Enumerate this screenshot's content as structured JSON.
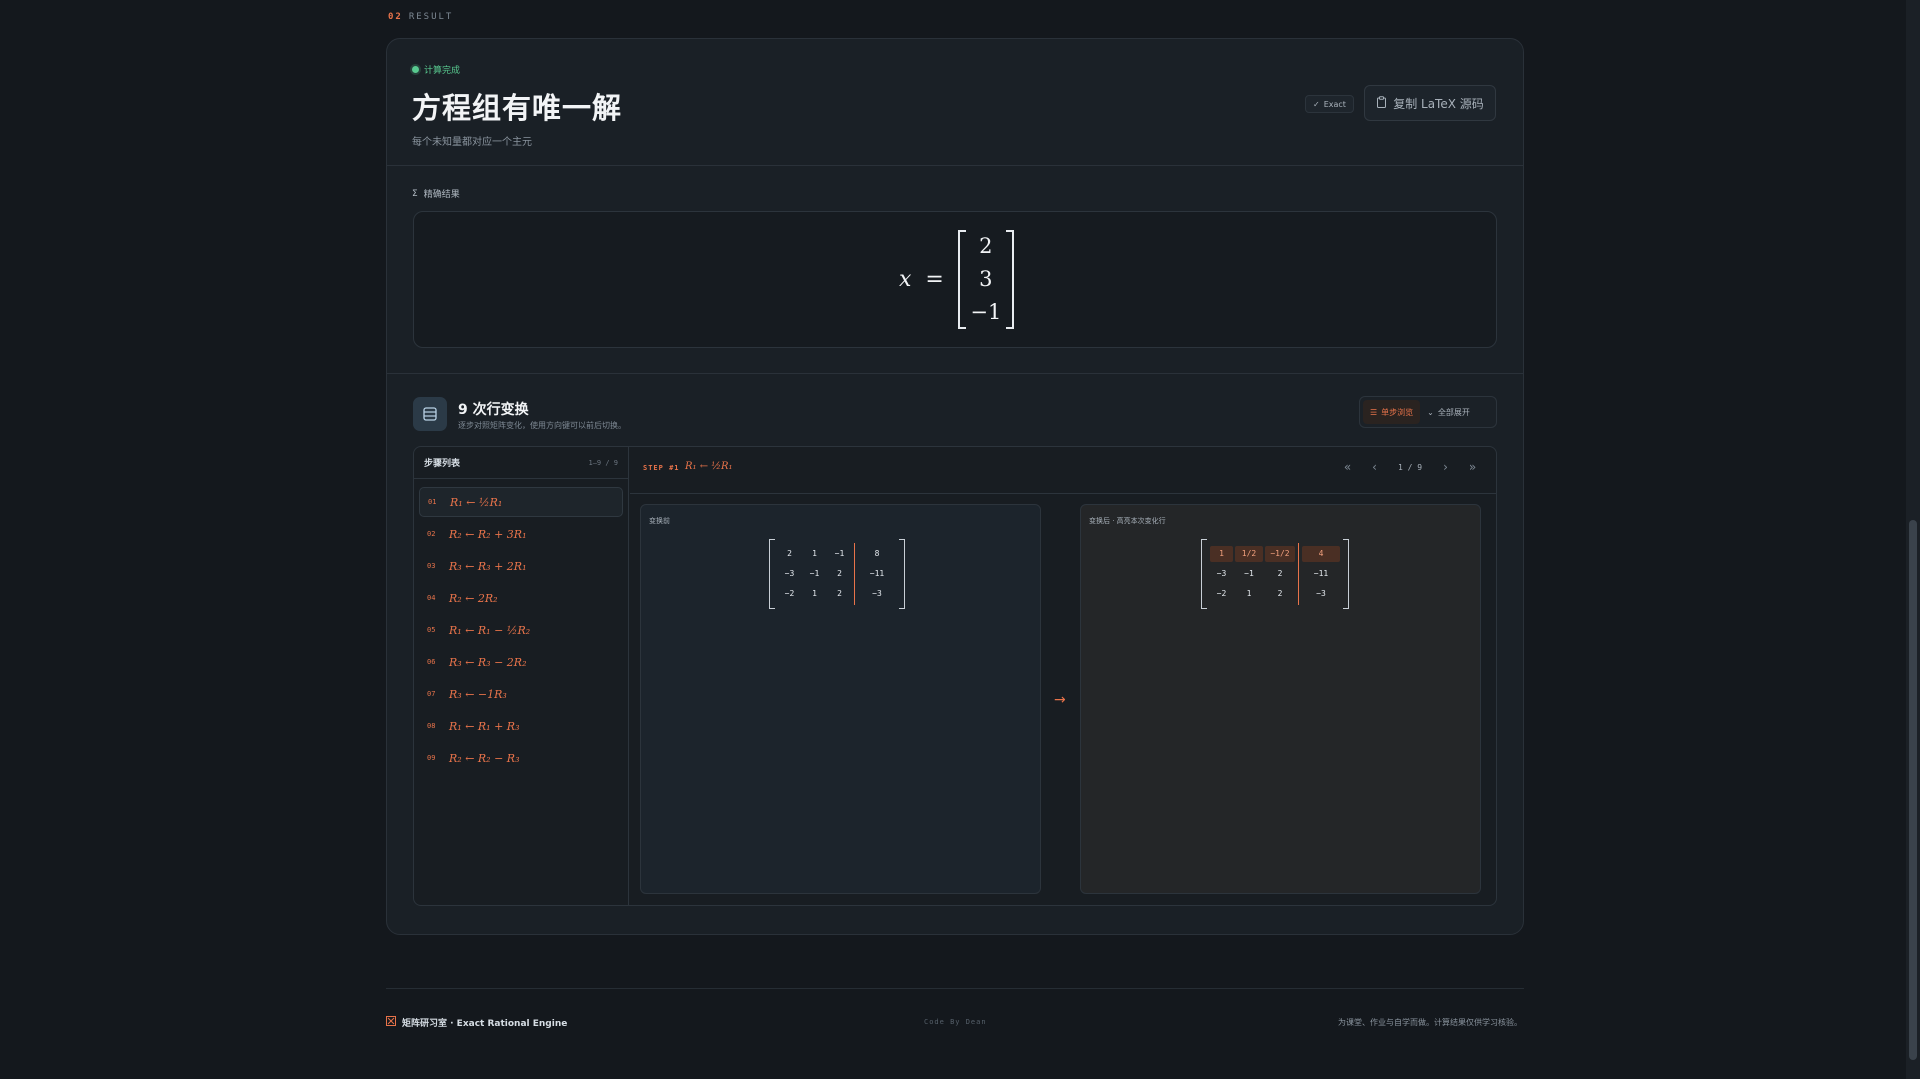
{
  "section": {
    "num": "02",
    "label": "RESULT"
  },
  "header": {
    "status": "计算完成",
    "title": "方程组有唯一解",
    "subtitle": "每个未知量都对应一个主元",
    "exact_badge": "Exact",
    "copy_button": "复制 LaTeX 源码"
  },
  "result": {
    "label": "精确结果",
    "variable": "x",
    "equals": "=",
    "vector": [
      "2",
      "3",
      "−1"
    ]
  },
  "steps": {
    "title": "9 次行变换",
    "subtitle": "逐步对照矩阵变化，使用方向键可以前后切换。",
    "toggle_single": "单步浏览",
    "toggle_all": "全部展开",
    "list_title": "步骤列表",
    "list_range": "1–9 / 9",
    "items": [
      {
        "num": "01",
        "op": "R₁ ← ½R₁"
      },
      {
        "num": "02",
        "op": "R₂ ← R₂ + 3R₁"
      },
      {
        "num": "03",
        "op": "R₃ ← R₃ + 2R₁"
      },
      {
        "num": "04",
        "op": "R₂ ← 2R₂"
      },
      {
        "num": "05",
        "op": "R₁ ← R₁ − ½R₂"
      },
      {
        "num": "06",
        "op": "R₃ ← R₃ − 2R₂"
      },
      {
        "num": "07",
        "op": "R₃ ← −1R₃"
      },
      {
        "num": "08",
        "op": "R₁ ← R₁ + R₃"
      },
      {
        "num": "09",
        "op": "R₂ ← R₂ − R₃"
      }
    ],
    "current_tag": "STEP #1",
    "current_op": "R₁ ← ½R₁",
    "pager": {
      "first": "«",
      "prev": "‹",
      "count": "1 / 9",
      "next": "›",
      "last": "»"
    },
    "before_label": "变换前",
    "after_label": "变换后 · 高亮本次变化行",
    "arrow": "→",
    "before_matrix": [
      [
        "2",
        "1",
        "−1",
        "8"
      ],
      [
        "−3",
        "−1",
        "2",
        "−11"
      ],
      [
        "−2",
        "1",
        "2",
        "−3"
      ]
    ],
    "after_matrix": [
      [
        "1",
        "1/2",
        "−1/2",
        "4"
      ],
      [
        "−3",
        "−1",
        "2",
        "−11"
      ],
      [
        "−2",
        "1",
        "2",
        "−3"
      ]
    ]
  },
  "footer": {
    "left": "矩阵研习室 · Exact Rational Engine",
    "mid": "Code By Dean",
    "right": "为课堂、作业与自学而做。计算结果仅供学习核验。"
  },
  "colors": {
    "accent": "#e8734a",
    "success": "#58c98f",
    "background": "#14181d"
  }
}
